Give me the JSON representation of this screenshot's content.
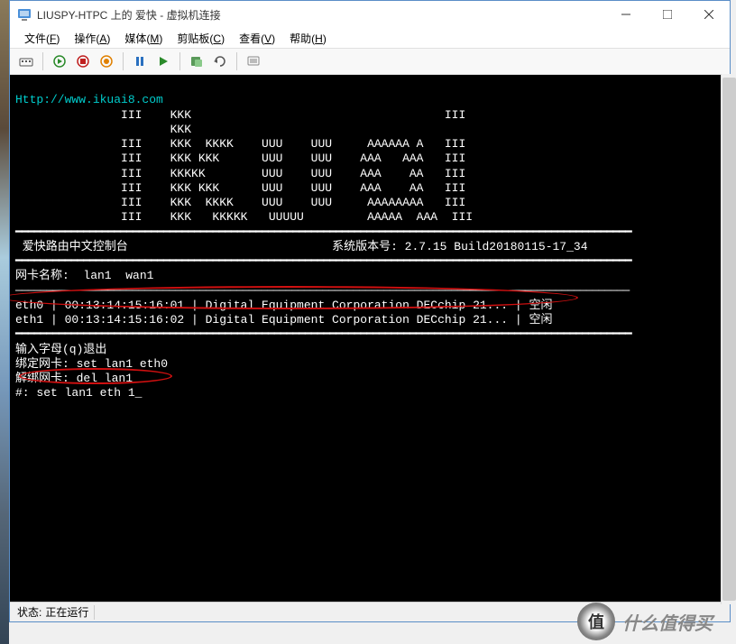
{
  "window": {
    "title": "LIUSPY-HTPC 上的 爱快 - 虚拟机连接"
  },
  "menu": {
    "file": "文件",
    "file_key": "F",
    "action": "操作",
    "action_key": "A",
    "media": "媒体",
    "media_key": "M",
    "clipboard": "剪贴板",
    "clipboard_key": "C",
    "view": "查看",
    "view_key": "V",
    "help": "帮助",
    "help_key": "H"
  },
  "terminal": {
    "url": "Http://www.ikuai8.com",
    "ascii_art": "               III    KKK                                    III\n                      KKK\n               III    KKK  KKKK    UUU    UUU     AAAAAA A   III\n               III    KKK KKK      UUU    UUU    AAA   AAA   III\n               III    KKKKK        UUU    UUU    AAA    AA   III\n               III    KKK KKK      UUU    UUU    AAA    AA   III\n               III    KKK  KKKK    UUU    UUU     AAAAAAAA   III\n               III    KKK   KKKKK   UUUUU         AAAAA  AAA  III",
    "divider_top": "━━━━━━━━━━━━━━━━━━━━━━━━━━━━━━━━━━━━━━━━━━━━━━━━━━━━━━━━━━━━━━━━━━━━━━━━━━━━━━━━━━━━━━━━━━━━━━━━━━━━",
    "console_title": " 爱快路由中文控制台",
    "version_label": "系统版本号: ",
    "version": "2.7.15 Build20180115-17_34",
    "divider_mid": "━━━━━━━━━━━━━━━━━━━━━━━━━━━━━━━━━━━━━━━━━━━━━━━━━━━━━━━━━━━━━━━━━━━━━━━━━━━━━━━━━━━━━━━━━━━━━━━━━━━━",
    "nic_label": "网卡名称:  lan1  wan1",
    "divider_nic": "────────────────────────────────────────────────────────────────────────────────────────────────────",
    "eth0": "eth0 | 00:13:14:15:16:01 | Digital Equipment Corporation DECchip 21... | 空闲",
    "eth1": "eth1 | 00:13:14:15:16:02 | Digital Equipment Corporation DECchip 21... | 空闲",
    "divider_eth": "━━━━━━━━━━━━━━━━━━━━━━━━━━━━━━━━━━━━━━━━━━━━━━━━━━━━━━━━━━━━━━━━━━━━━━━━━━━━━━━━━━━━━━━━━━━━━━━━━━━━",
    "help_quit": "输入字母(q)退出",
    "help_bind": "绑定网卡: set lan1 eth0",
    "help_unbind": "解绑网卡: del lan1",
    "prompt": "#: set lan1 eth 1_"
  },
  "status": {
    "label": "状态:",
    "value": "正在运行"
  },
  "watermark": {
    "badge": "值",
    "text": "什么值得买"
  }
}
